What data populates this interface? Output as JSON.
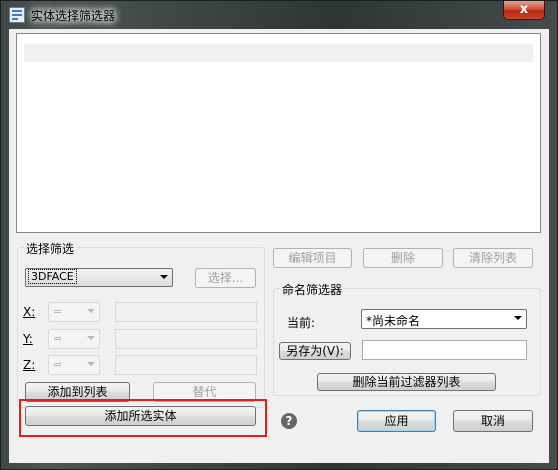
{
  "window": {
    "title": "实体选择筛选器",
    "close_glyph": "x"
  },
  "select_filter": {
    "group_label": "选择筛选",
    "entity_type": "3DFACE",
    "select_button": "选择...",
    "coords": [
      {
        "axis": "X:",
        "op": "="
      },
      {
        "axis": "Y:",
        "op": "="
      },
      {
        "axis": "Z:",
        "op": "="
      }
    ],
    "add_to_list": "添加到列表",
    "substitute": "替代",
    "add_selected": "添加所选实体"
  },
  "list_actions": {
    "edit": "编辑项目",
    "delete": "删除",
    "clear": "清除列表"
  },
  "named_filter": {
    "group_label": "命名筛选器",
    "current_label": "当前:",
    "current_value": "*尚未命名",
    "save_as": "另存为(V):",
    "delete_current": "删除当前过滤器列表"
  },
  "footer": {
    "apply": "应用",
    "cancel": "取消",
    "help_glyph": "?"
  }
}
